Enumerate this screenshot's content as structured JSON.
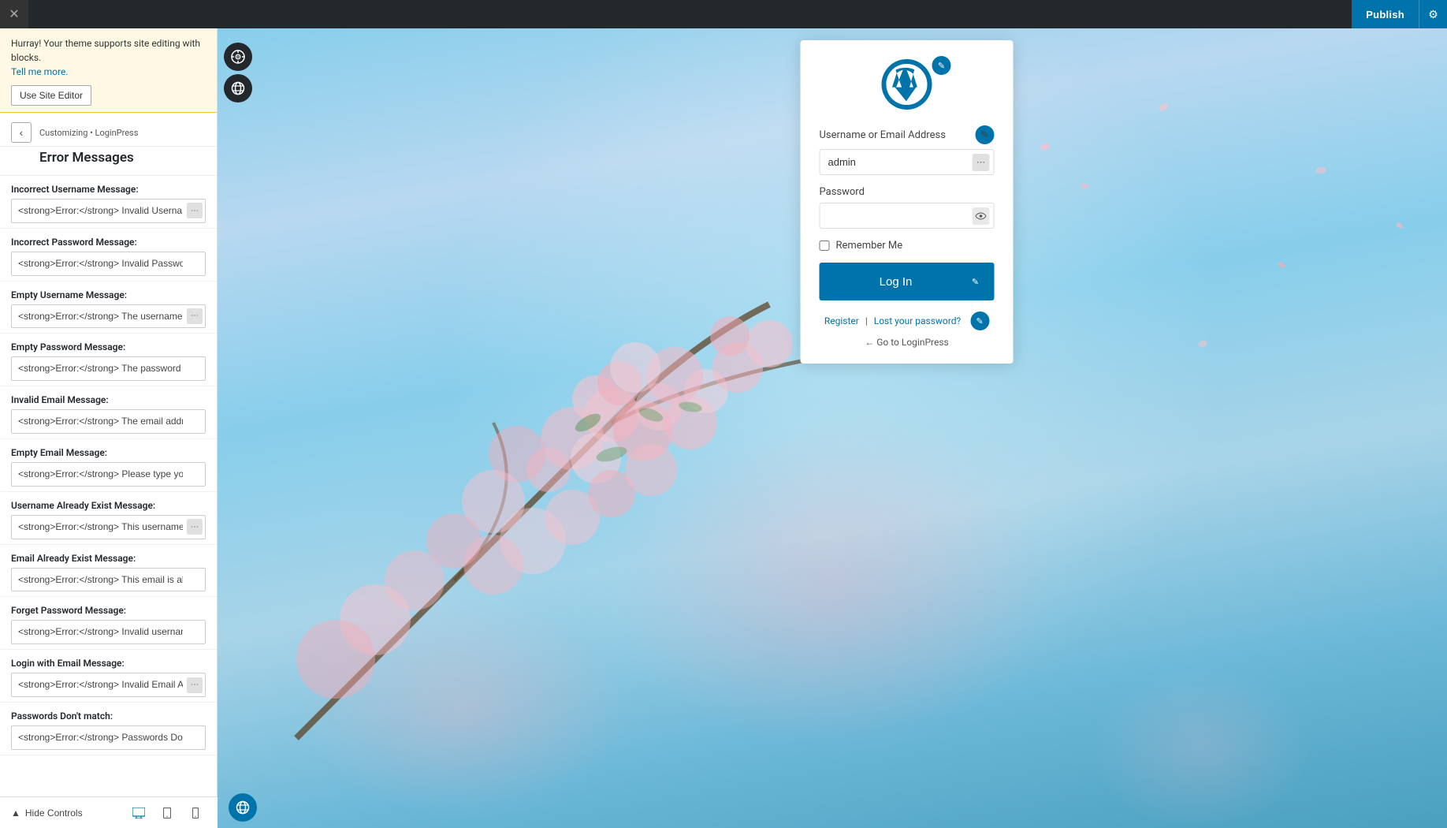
{
  "topbar": {
    "publish_label": "Publish",
    "close_icon": "✕",
    "settings_icon": "⚙"
  },
  "notification": {
    "message": "Hurray! Your theme supports site editing with blocks.",
    "link_text": "Tell me more.",
    "button_label": "Use Site Editor"
  },
  "breadcrumb": {
    "back_icon": "‹",
    "path": "Customizing • LoginPress",
    "title": "Error Messages"
  },
  "fields": [
    {
      "label": "Incorrect Username Message:",
      "value": "<strong>Error:</strong> Invalid Username.",
      "id": "incorrect-username"
    },
    {
      "label": "Incorrect Password Message:",
      "value": "<strong>Error:</strong> Invalid Password.",
      "id": "incorrect-password"
    },
    {
      "label": "Empty Username Message:",
      "value": "<strong>Error:</strong> The username field",
      "id": "empty-username"
    },
    {
      "label": "Empty Password Message:",
      "value": "<strong>Error:</strong> The password field is e",
      "id": "empty-password"
    },
    {
      "label": "Invalid Email Message:",
      "value": "<strong>Error:</strong> The email address isn't",
      "id": "invalid-email"
    },
    {
      "label": "Empty Email Message:",
      "value": "<strong>Error:</strong> Please type your email",
      "id": "empty-email"
    },
    {
      "label": "Username Already Exist Message:",
      "value": "<strong>Error:</strong> This username is al",
      "id": "username-exists"
    },
    {
      "label": "Email Already Exist Message:",
      "value": "<strong>Error:</strong> This email is already re",
      "id": "email-exists"
    },
    {
      "label": "Forget Password Message:",
      "value": "<strong>Error:</strong> Invalid username or em",
      "id": "forget-password"
    },
    {
      "label": "Login with Email Message:",
      "value": "<strong>Error:</strong> Invalid Email Addre",
      "id": "login-email"
    },
    {
      "label": "Passwords Don't match:",
      "value": "<strong>Error:</strong> Passwords Don't match",
      "id": "passwords-match"
    }
  ],
  "bottom_bar": {
    "hide_controls_label": "Hide Controls",
    "desktop_icon": "🖥",
    "tablet_icon": "📱",
    "mobile_icon": "📱"
  },
  "login_card": {
    "username_label": "Username or Email Address",
    "username_value": "admin",
    "username_placeholder": "admin",
    "password_label": "Password",
    "password_value": "",
    "remember_label": "Remember Me",
    "login_button": "Log In",
    "register_link": "Register",
    "lost_password_link": "Lost your password?",
    "go_loginpress": "← Go to LoginPress",
    "edit_pencil": "✎"
  },
  "right_sidebar": {
    "wrench_icon": "🔧",
    "globe_icon": "🌐"
  },
  "colors": {
    "primary": "#0073aa",
    "dark": "#23282d"
  }
}
